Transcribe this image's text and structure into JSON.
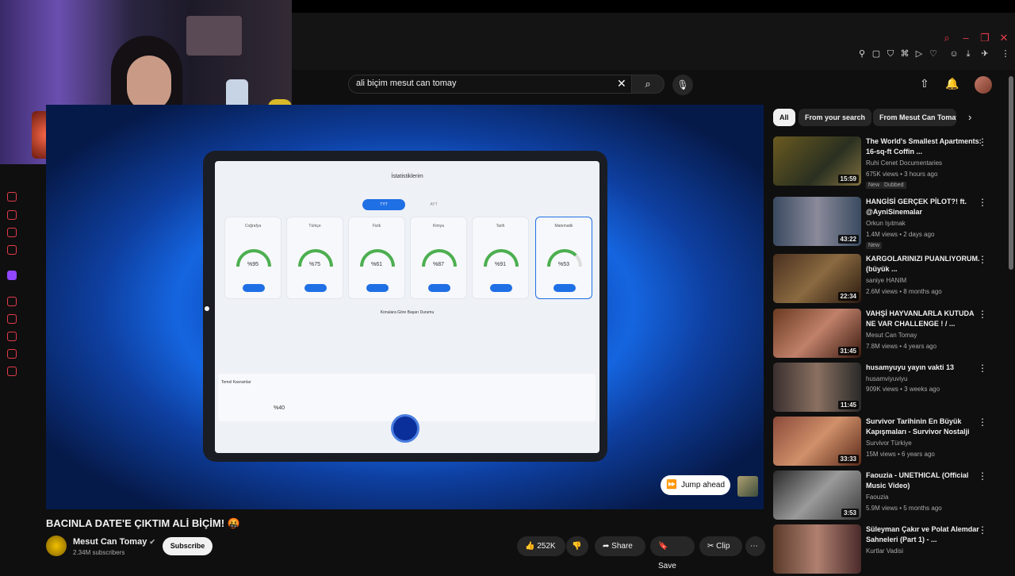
{
  "search": {
    "query": "ali biçim mesut can tomay"
  },
  "video": {
    "title": "BACINLA DATE'E ÇIKTIM ALİ BİÇİM! 🤬",
    "channel": "Mesut Can Tomay",
    "subscribers": "2.34M subscribers",
    "subscribe_label": "Subscribe",
    "likes": "252K",
    "share_label": "Share",
    "save_label": "Save",
    "clip_label": "Clip",
    "jump_label": "Jump ahead"
  },
  "screen": {
    "title": "İstatistiklerim",
    "tabs": [
      "TYT",
      "AYT"
    ],
    "cards": [
      {
        "subject": "Coğrafya",
        "value": "%95"
      },
      {
        "subject": "Türkçe",
        "value": "%75"
      },
      {
        "subject": "Fizik",
        "value": "%61"
      },
      {
        "subject": "Kimya",
        "value": "%87"
      },
      {
        "subject": "Tarih",
        "value": "%91"
      },
      {
        "subject": "Matematik",
        "value": "%53"
      }
    ],
    "section": "Konulara Göre Başarı Durumu",
    "basics": "Temel Kavramlar",
    "basics_value": "%40"
  },
  "chips": [
    "All",
    "From your search",
    "From Mesut Can Tomay"
  ],
  "recommended": [
    {
      "title": "The World's Smallest Apartments: 16-sq-ft Coffin ...",
      "channel": "Ruhi Cenet Documentaries",
      "meta": "675K views • 3 hours ago",
      "badges": [
        "New",
        "Dubbed"
      ],
      "duration": "15:59"
    },
    {
      "title": "HANGİSİ GERÇEK PİLOT?! ft. @AyniSinemalar",
      "channel": "Orkun Işıtmak",
      "meta": "1.4M views • 2 days ago",
      "badges": [
        "New"
      ],
      "duration": "43:22"
    },
    {
      "title": "KARGOLARINIZI PUANLIYORUM. (büyük ...",
      "channel": "saniye HANIM",
      "meta": "2.6M views • 8 months ago",
      "badges": [],
      "duration": "22:34"
    },
    {
      "title": "VAHŞİ HAYVANLARLA KUTUDA NE VAR CHALLENGE ! / ...",
      "channel": "Mesut Can Tomay",
      "meta": "7.8M views • 4 years ago",
      "badges": [],
      "duration": "31:45"
    },
    {
      "title": "husamyuyu yayın vakti 13",
      "channel": "husamviyuviyu",
      "meta": "909K views • 3 weeks ago",
      "badges": [],
      "duration": "11:45"
    },
    {
      "title": "Survivor Tarihinin En Büyük Kapışmaları - Survivor Nostalji",
      "channel": "Survivor Türkiye",
      "meta": "15M views • 6 years ago",
      "badges": [],
      "duration": "33:33"
    },
    {
      "title": "Faouzia - UNETHICAL (Official Music Video)",
      "channel": "Faouzia",
      "meta": "5.9M views • 5 months ago",
      "badges": [],
      "duration": "3:53"
    },
    {
      "title": "Süleyman Çakır ve Polat Alemdar Sahneleri (Part 1) - ...",
      "channel": "Kurtlar Vadisi",
      "meta": "",
      "badges": [],
      "duration": ""
    }
  ],
  "colors": {
    "accent": "#e53b4b",
    "bg": "#0f0f0f"
  }
}
